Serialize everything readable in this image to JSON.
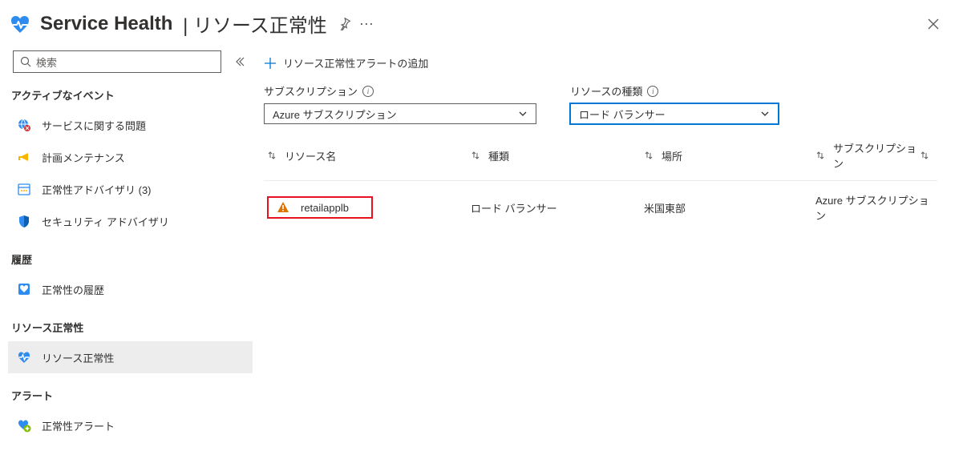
{
  "header": {
    "title": "Service Health",
    "subtitle": "リソース正常性"
  },
  "search": {
    "placeholder": "検索"
  },
  "nav": {
    "active_events": {
      "title": "アクティブなイベント",
      "items": [
        {
          "label": "サービスに関する問題"
        },
        {
          "label": "計画メンテナンス"
        },
        {
          "label": "正常性アドバイザリ (3)"
        },
        {
          "label": "セキュリティ アドバイザリ"
        }
      ]
    },
    "history": {
      "title": "履歴",
      "items": [
        {
          "label": "正常性の履歴"
        }
      ]
    },
    "resource_health": {
      "title": "リソース正常性",
      "items": [
        {
          "label": "リソース正常性"
        }
      ]
    },
    "alerts": {
      "title": "アラート",
      "items": [
        {
          "label": "正常性アラート"
        }
      ]
    }
  },
  "commands": {
    "add_alert": "リソース正常性アラートの追加"
  },
  "filters": {
    "subscription": {
      "label": "サブスクリプション",
      "value": "Azure サブスクリプション"
    },
    "resource_type": {
      "label": "リソースの種類",
      "value": "ロード バランサー"
    }
  },
  "columns": {
    "name": "リソース名",
    "type": "種類",
    "location": "場所",
    "subscription": "サブスクリプション"
  },
  "rows": [
    {
      "name": "retailapplb",
      "type": "ロード バランサー",
      "location": "米国東部",
      "subscription": "Azure サブスクリプション"
    }
  ]
}
